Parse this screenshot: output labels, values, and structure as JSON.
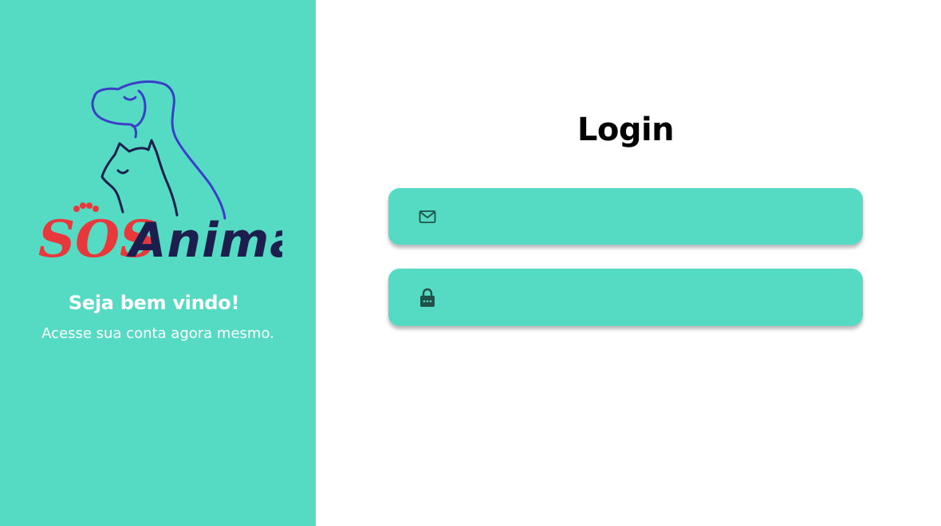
{
  "brand": {
    "logo_text_part1": "SOS",
    "logo_text_part2": "Animal",
    "logo_red": "#e8383b",
    "logo_navy": "#1c1f4d",
    "logo_blue": "#3b3fc7"
  },
  "welcome": {
    "title": "Seja bem vindo!",
    "subtitle": "Acesse sua conta agora mesmo."
  },
  "login": {
    "title": "Login",
    "email_field": {
      "icon": "mail-icon",
      "value": "",
      "placeholder": ""
    },
    "password_field": {
      "icon": "lock-icon",
      "value": "",
      "placeholder": ""
    }
  },
  "colors": {
    "accent": "#55dbc3",
    "icon": "#1f5248",
    "background": "#ffffff"
  }
}
